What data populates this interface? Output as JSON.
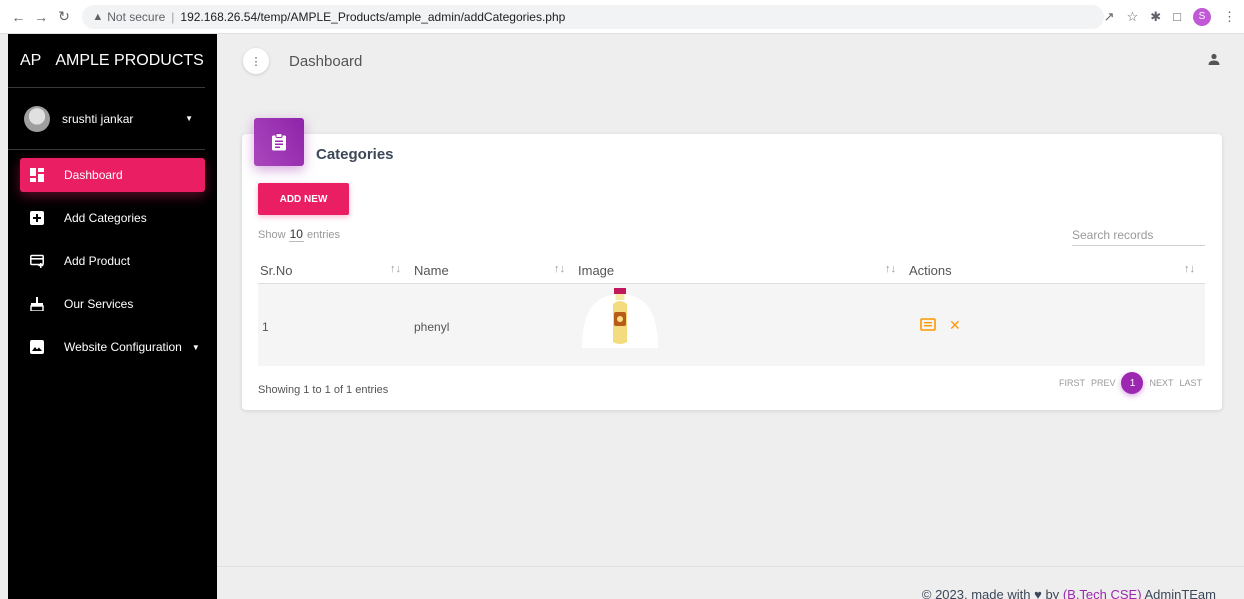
{
  "browser": {
    "security_label": "Not secure",
    "url": "192.168.26.54/temp/AMPLE_Products/ample_admin/addCategories.php",
    "profile_initial": "S"
  },
  "sidebar": {
    "brand_mini": "AP",
    "brand_name": "AMPLE PRODUCTS",
    "user_name": "srushti jankar",
    "items": [
      {
        "label": "Dashboard",
        "icon": "dashboard-icon",
        "active": true
      },
      {
        "label": "Add Categories",
        "icon": "add-box-icon",
        "active": false
      },
      {
        "label": "Add Product",
        "icon": "add-card-icon",
        "active": false
      },
      {
        "label": "Our Services",
        "icon": "cleaning-icon",
        "active": false
      },
      {
        "label": "Website Configuration",
        "icon": "image-icon",
        "active": false
      }
    ]
  },
  "topbar": {
    "title": "Dashboard"
  },
  "card": {
    "title": "Categories",
    "add_label": "ADD NEW",
    "show_prefix": "Show",
    "show_count": "10",
    "show_suffix": "entries",
    "search_placeholder": "Search records",
    "columns": [
      "Sr.No",
      "Name",
      "Image",
      "Actions"
    ],
    "rows": [
      {
        "srno": "1",
        "name": "phenyl",
        "image": "phenyl-bottle"
      }
    ],
    "showing": "Showing 1 to 1 of 1 entries",
    "pager": {
      "first": "FIRST",
      "prev": "PREV",
      "current": "1",
      "next": "NEXT",
      "last": "LAST"
    }
  },
  "footer": {
    "prefix": "© 2023, made with",
    "by": "by",
    "team_link": "(B.Tech CSE)",
    "team": "AdminTEam"
  },
  "colors": {
    "accent": "#e91e63",
    "purple": "#9c27b0",
    "action_orange": "#ff9800"
  }
}
